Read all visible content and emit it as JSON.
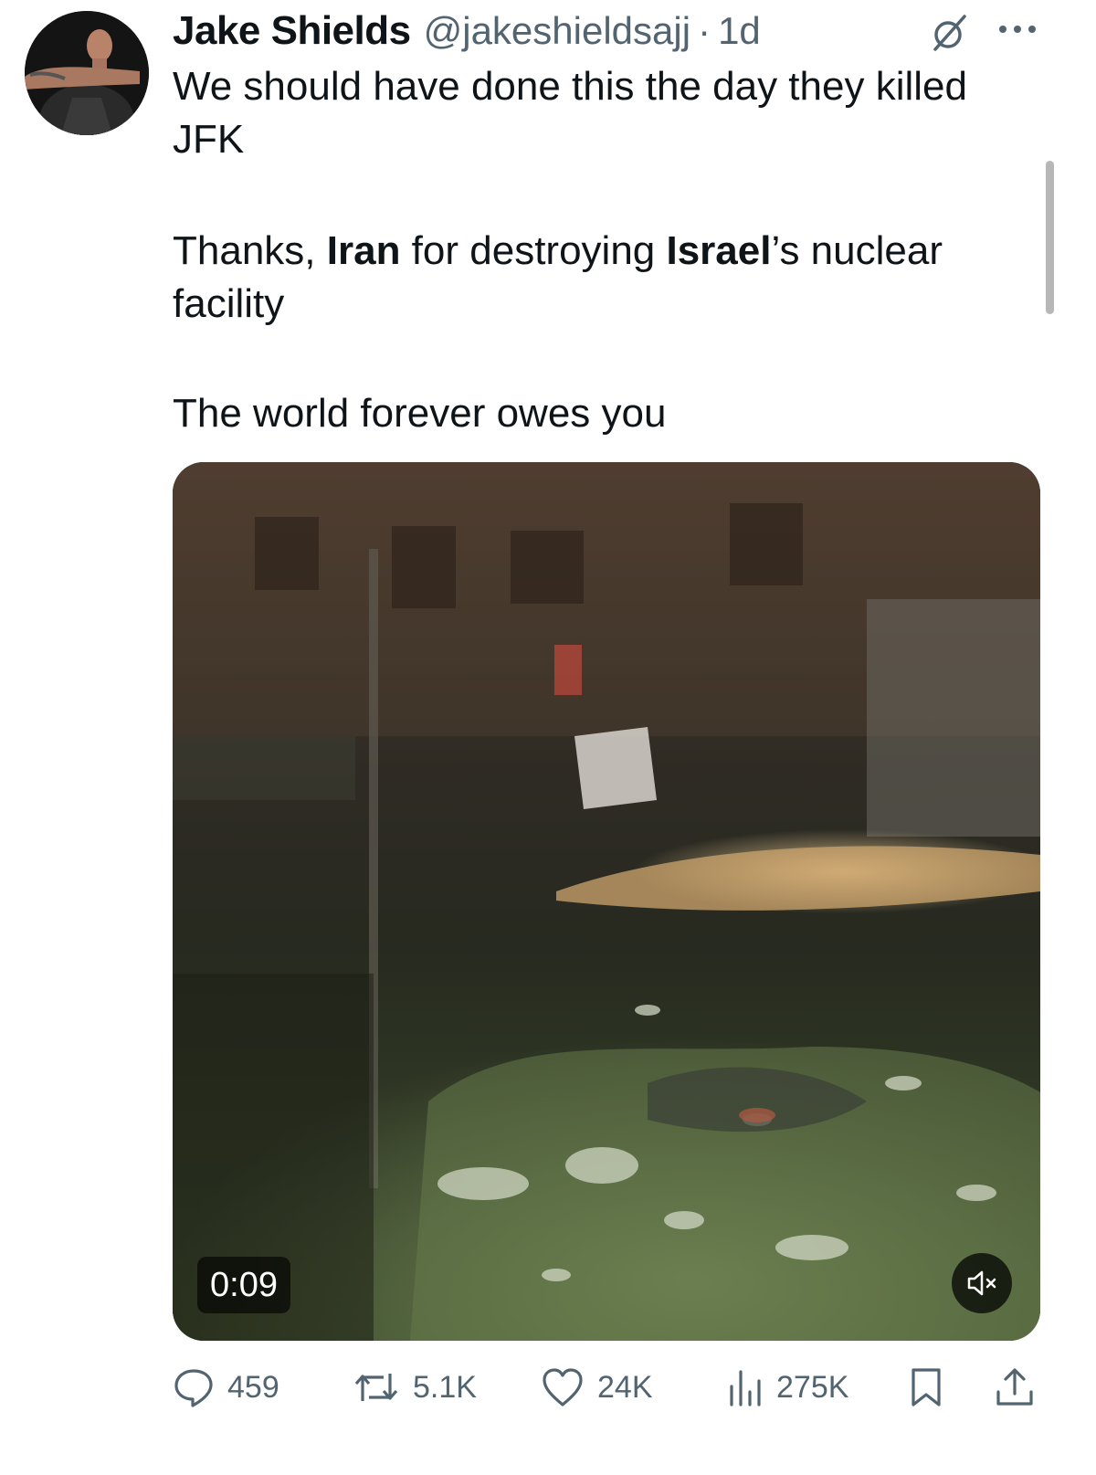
{
  "tweet": {
    "author_name": "Jake Shields",
    "handle": "@jakeshieldsajj",
    "separator": "·",
    "time": "1d",
    "text": {
      "line1": "We should have done this the day they killed JFK",
      "line2_a": "Thanks, ",
      "line2_b": "Iran",
      "line2_c": " for destroying ",
      "line2_d": "Israel",
      "line2_e": "’s nuclear facility",
      "line3": "The world forever owes you"
    },
    "media": {
      "duration": "0:09",
      "muted": true
    },
    "metrics": {
      "replies": "459",
      "reposts": "5.1K",
      "likes": "24K",
      "views": "275K"
    }
  },
  "icons": {
    "grok": "grok-icon",
    "more": "more-icon",
    "reply": "reply-icon",
    "repost": "repost-icon",
    "like": "like-icon",
    "views": "views-icon",
    "bookmark": "bookmark-icon",
    "share": "share-icon",
    "mute": "mute-icon"
  },
  "colors": {
    "text": "#0f1419",
    "secondary": "#536471"
  }
}
